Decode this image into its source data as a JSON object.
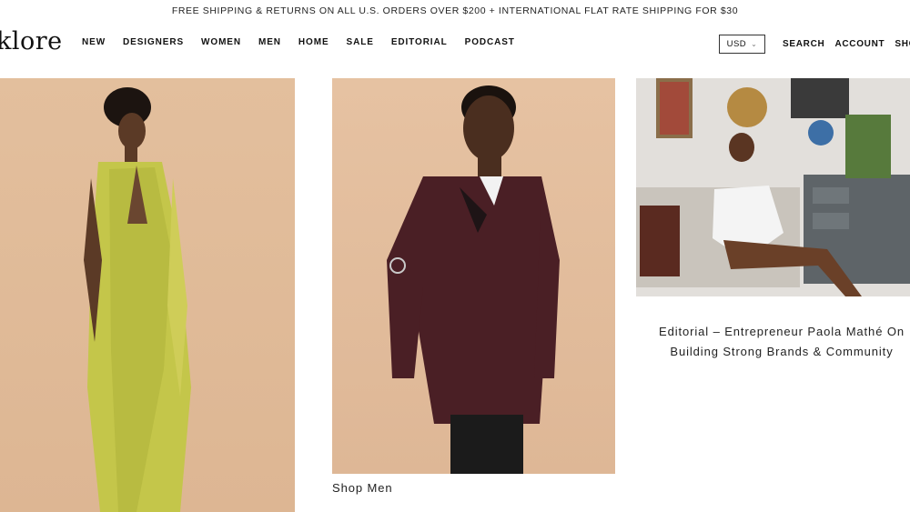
{
  "announcement": "FREE SHIPPING & RETURNS ON ALL U.S. ORDERS OVER $200 + INTERNATIONAL FLAT RATE SHIPPING FOR $30",
  "header": {
    "logo": "klore",
    "nav": [
      "NEW",
      "DESIGNERS",
      "WOMEN",
      "MEN",
      "HOME",
      "SALE",
      "EDITORIAL",
      "PODCAST"
    ],
    "currency": "USD",
    "utilities": [
      "SEARCH",
      "ACCOUNT",
      "SHOP"
    ]
  },
  "tiles": {
    "men_caption": "Shop Men",
    "editorial_caption_line1": "Editorial – Entrepreneur Paola Mathé On",
    "editorial_caption_line2": "Building Strong Brands & Community"
  },
  "colors": {
    "photo_backdrop": "#e3bf9d",
    "text": "#111111"
  }
}
